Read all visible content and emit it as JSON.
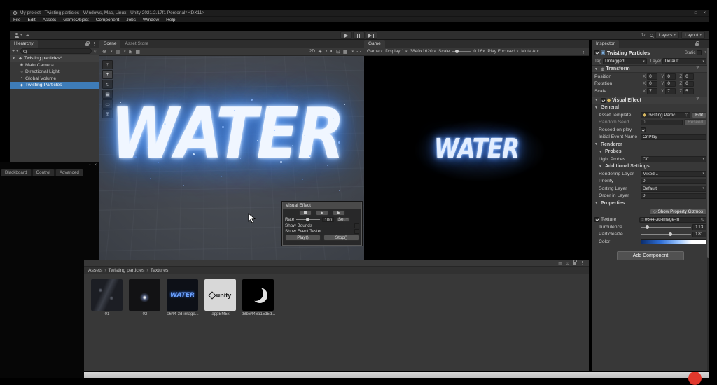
{
  "colors": {
    "selection_blue": "#3e7cb8",
    "particle_glow_blue": "#4d8fe8",
    "water_core": "#f0f6ff",
    "taskbar_gray": "#c8c8c8",
    "record_red": "#e0382c"
  },
  "icons": {
    "caret_down": "▾",
    "foldout_open": "▼",
    "kebab": "⋮",
    "help": "?",
    "plus": "+",
    "cloud": "☁",
    "close": "×",
    "square": "▫",
    "crumb_sep": "›",
    "scene_icon": "◆",
    "camera_icon": "◉",
    "light_icon": "☼",
    "volume_icon": "◓",
    "particles_icon": "◆",
    "pivot_icon": "⊕",
    "local_icon": "▤",
    "snap_icon": "⊞",
    "grid_icon": "▦",
    "sun_icon": "☀",
    "audio_icon": "♪",
    "fx_icon": "◐",
    "boxed_icon": "⊡",
    "ellipsis_icon": "⋯",
    "refresh_icon": "↻",
    "picker_icon": "⊙",
    "tool_view": "⊙",
    "tool_move": "+",
    "tool_rotate": "↻",
    "tool_scale": "▣",
    "tool_rect": "▭",
    "tool_transform": "⊞",
    "gizmo_icon": "◇",
    "asset_lines": "≡",
    "cube_icon": "▣"
  },
  "title_bar": {
    "title": "My project - Twisting particles - Windows, Mac, Linux - Unity 2021.2.17f1 Personal* <DX11>",
    "minimize": "–",
    "maximize": "□",
    "close": "×"
  },
  "menu": {
    "items": [
      "File",
      "Edit",
      "Assets",
      "GameObject",
      "Component",
      "Jobs",
      "Window",
      "Help"
    ]
  },
  "toolbar": {
    "layers": "Layers",
    "layout": "Layout"
  },
  "hierarchy": {
    "tab": "Hierarchy",
    "scene_name": "Twisting particles*",
    "items": [
      {
        "label": "Main Camera"
      },
      {
        "label": "Directional Light"
      },
      {
        "label": "Global Volume"
      },
      {
        "label": "Twisting Particles"
      }
    ]
  },
  "blackboard": {
    "tabs": [
      "Blackboard",
      "Control",
      "Advanced"
    ]
  },
  "scene": {
    "tab_scene": "Scene",
    "tab_asset_store": "Asset Store",
    "toggle_2d": "2D",
    "water": "WATER"
  },
  "game": {
    "tab": "Game",
    "menu": "Game",
    "display": "Display 1",
    "resolution": "3840x1620",
    "scale_label": "Scale",
    "scale_value": "0.16x",
    "play_focused": "Play Focused",
    "mute": "Mute Audio",
    "water": "WATER"
  },
  "vfx_panel": {
    "title": "Visual Effect",
    "rate_label": "Rate",
    "rate_value": "100",
    "set_button": "Set",
    "show_bounds": "Show Bounds",
    "show_event_tester": "Show Event Tester",
    "play_button": "Play()",
    "stop_button": "Stop()"
  },
  "inspector": {
    "tab": "Inspector",
    "object_name": "Twisting Particles",
    "static_label": "Static",
    "tag_label": "Tag",
    "tag_value": "Untagged",
    "layer_label": "Layer",
    "layer_value": "Default",
    "transform": {
      "title": "Transform",
      "axis_x": "X",
      "axis_y": "Y",
      "axis_z": "Z",
      "rows": [
        {
          "label": "Position",
          "x": "0",
          "y": "0",
          "z": "0"
        },
        {
          "label": "Rotation",
          "x": "0",
          "y": "0",
          "z": "0"
        },
        {
          "label": "Scale",
          "x": "7",
          "y": "7",
          "z": "5"
        }
      ]
    },
    "visual_effect": {
      "title": "Visual Effect",
      "general": "General",
      "asset_template_label": "Asset Template",
      "asset_template_value": "Twisting Partic",
      "edit_button": "Edit",
      "random_seed_label": "Random Seed",
      "random_seed_value": "0",
      "reseed_button": "Reseed",
      "reseed_on_play_label": "Reseed on play",
      "initial_event_label": "Initial Event Name",
      "initial_event_value": "OnPlay",
      "renderer": "Renderer",
      "probes": "Probes",
      "light_probes_label": "Light Probes",
      "light_probes_value": "Off",
      "additional_settings": "Additional Settings",
      "rendering_layer_label": "Rendering Layer",
      "rendering_layer_value": "Mixed...",
      "priority_label": "Priority",
      "priority_value": "0",
      "sorting_layer_label": "Sorting Layer",
      "sorting_layer_value": "Default",
      "order_in_layer_label": "Order in Layer",
      "order_in_layer_value": "0",
      "properties": "Properties",
      "show_gizmos_button": "Show Property Gizmos",
      "texture_label": "Texture",
      "texture_value": "0644-3d-image-m",
      "turbulence_label": "Turbulence",
      "turbulence_value": "0.13",
      "particlesize_label": "Particlesize",
      "particlesize_value": "0.81",
      "color_label": "Color"
    },
    "add_component": "Add Component"
  },
  "project": {
    "breadcrumb": [
      "Assets",
      "Twisting particles",
      "Textures"
    ],
    "items": [
      {
        "label": "01"
      },
      {
        "label": "02"
      },
      {
        "label": "0644-3d-image...",
        "preview_text": "WATER"
      },
      {
        "label": "appBM5x",
        "preview_text": "unity"
      },
      {
        "label": "d8b6446a15d5d..."
      }
    ]
  }
}
